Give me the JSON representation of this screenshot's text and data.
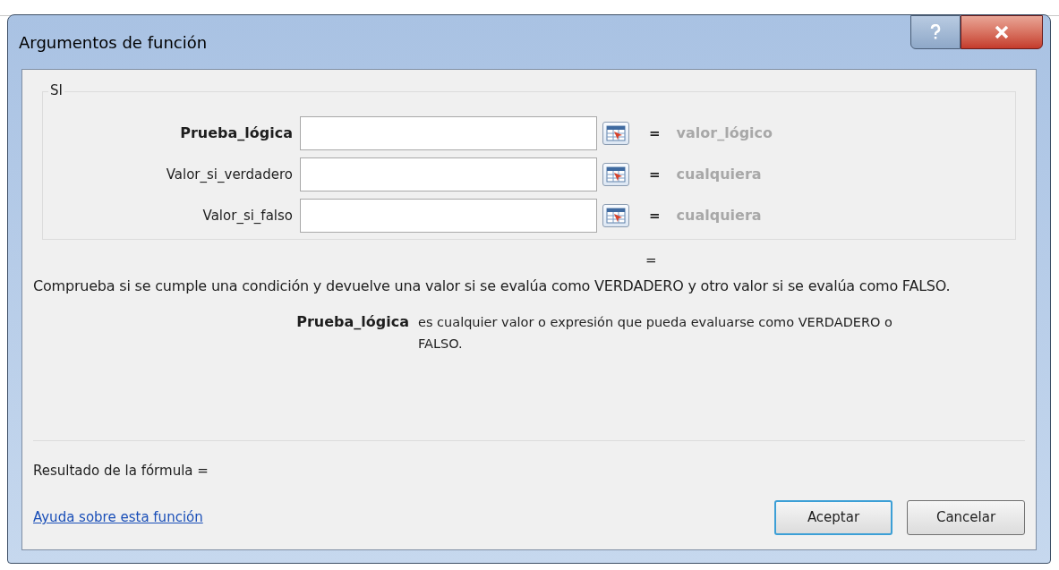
{
  "window": {
    "title": "Argumentos de función"
  },
  "function_name": "SI",
  "arguments": [
    {
      "label": "Prueba_lógica",
      "selected": true,
      "result": "valor_lógico",
      "equals": "="
    },
    {
      "label": "Valor_si_verdadero",
      "selected": false,
      "result": "cualquiera",
      "equals": "="
    },
    {
      "label": "Valor_si_falso",
      "selected": false,
      "result": "cualquiera",
      "equals": "="
    }
  ],
  "function_result": "=",
  "description": "Comprueba si se cumple una condición y devuelve una valor si se evalúa como VERDADERO y otro valor si se evalúa como FALSO.",
  "argument_help": {
    "name": "Prueba_lógica",
    "text": "es cualquier valor o expresión que pueda evaluarse como VERDADERO o FALSO."
  },
  "formula_result": "Resultado de la fórmula =",
  "help_link": "Ayuda sobre esta función",
  "buttons": [
    {
      "label": "Aceptar",
      "default": true
    },
    {
      "label": "Cancelar",
      "default": false
    }
  ]
}
